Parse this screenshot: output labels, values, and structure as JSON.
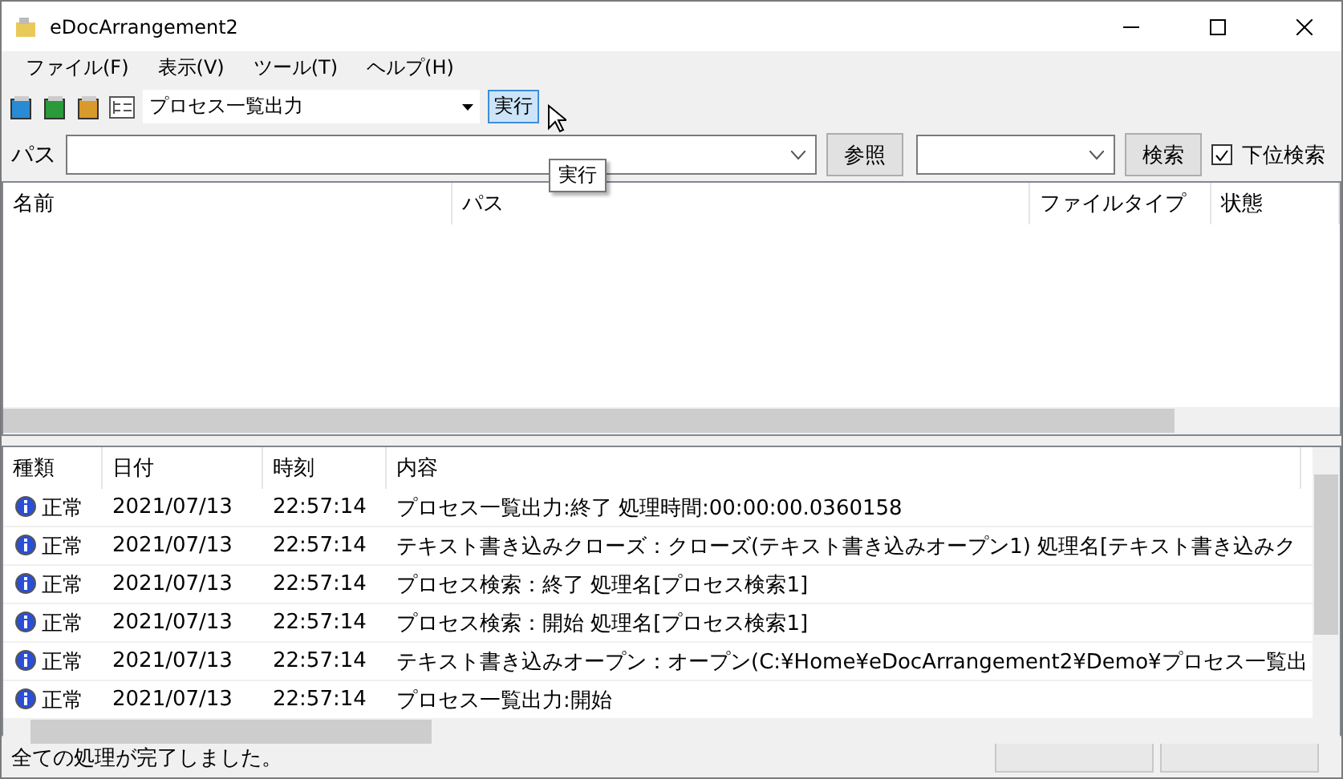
{
  "window": {
    "title": "eDocArrangement2"
  },
  "menu": [
    "ファイル(F)",
    "表示(V)",
    "ツール(T)",
    "ヘルプ(H)"
  ],
  "toolbar": {
    "process": "プロセス一覧出力",
    "run_button": "実行",
    "tooltip": "実行"
  },
  "path_row": {
    "label": "パス",
    "browse_button": "参照",
    "search_button": "検索",
    "subfolder": {
      "label": "下位検索",
      "checked": true
    }
  },
  "file_list": {
    "columns": [
      "名前",
      "パス",
      "ファイルタイプ",
      "状態"
    ]
  },
  "log": {
    "columns": [
      "種類",
      "日付",
      "時刻",
      "内容"
    ],
    "rows": [
      {
        "type": "正常",
        "date": "2021/07/13",
        "time": "22:57:14",
        "content": "プロセス一覧出力:終了 処理時間:00:00:00.0360158"
      },
      {
        "type": "正常",
        "date": "2021/07/13",
        "time": "22:57:14",
        "content": "テキスト書き込みクローズ：クローズ(テキスト書き込みオープン1) 処理名[テキスト書き込みク"
      },
      {
        "type": "正常",
        "date": "2021/07/13",
        "time": "22:57:14",
        "content": "プロセス検索：終了 処理名[プロセス検索1]"
      },
      {
        "type": "正常",
        "date": "2021/07/13",
        "time": "22:57:14",
        "content": "プロセス検索：開始 処理名[プロセス検索1]"
      },
      {
        "type": "正常",
        "date": "2021/07/13",
        "time": "22:57:14",
        "content": "テキスト書き込みオープン：オープン(C:¥Home¥eDocArrangement2¥Demo¥プロセス一覧出"
      },
      {
        "type": "正常",
        "date": "2021/07/13",
        "time": "22:57:14",
        "content": "プロセス一覧出力:開始"
      }
    ]
  },
  "status_bar": {
    "message": "全ての処理が完了しました。"
  }
}
